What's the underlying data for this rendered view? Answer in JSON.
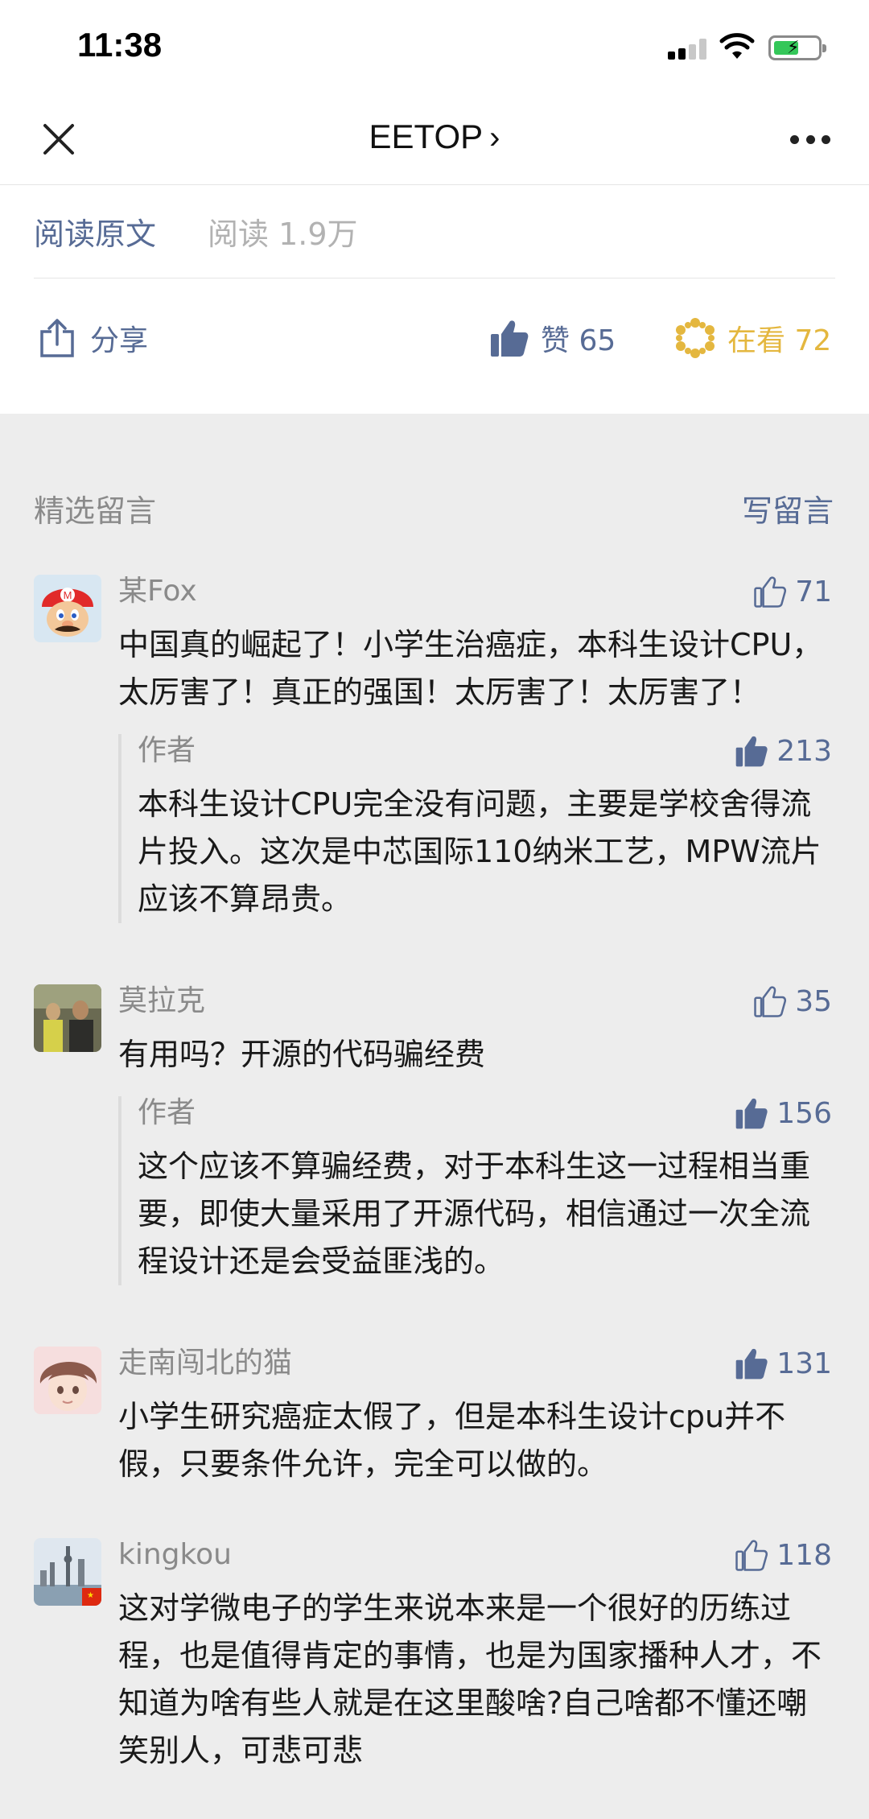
{
  "status_bar": {
    "time": "11:38"
  },
  "nav": {
    "title": "EETOP",
    "chevron": "›"
  },
  "read_row": {
    "original_link": "阅读原文",
    "read_count": "阅读 1.9万"
  },
  "actions": {
    "share_label": "分享",
    "like_label": "赞 65",
    "looking_label": "在看 72",
    "accent_blue": "#576b95",
    "accent_gold": "#e4b73f"
  },
  "comments_header": {
    "title": "精选留言",
    "write": "写留言"
  },
  "comments": [
    {
      "name": "某Fox",
      "likes": "71",
      "liked": false,
      "text": "中国真的崛起了！小学生治癌症，本科生设计CPU，太厉害了！真正的强国！太厉害了！太厉害了！",
      "reply": {
        "name": "作者",
        "likes": "213",
        "text": "本科生设计CPU完全没有问题，主要是学校舍得流片投入。这次是中芯国际110纳米工艺，MPW流片应该不算昂贵。"
      }
    },
    {
      "name": "莫拉克",
      "likes": "35",
      "liked": false,
      "text": "有用吗？开源的代码骗经费",
      "reply": {
        "name": "作者",
        "likes": "156",
        "text": "这个应该不算骗经费，对于本科生这一过程相当重要，即使大量采用了开源代码，相信通过一次全流程设计还是会受益匪浅的。"
      }
    },
    {
      "name": "走南闯北的猫",
      "likes": "131",
      "liked": true,
      "text": "小学生研究癌症太假了，但是本科生设计cpu并不假，只要条件允许，完全可以做的。"
    },
    {
      "name": "kingkou",
      "likes": "118",
      "liked": false,
      "text": "这对学微电子的学生来说本来是一个很好的历练过程，也是值得肯定的事情，也是为国家播种人才，不知道为啥有些人就是在这里酸啥?自己啥都不懂还嘲笑别人，可悲可悲"
    }
  ]
}
